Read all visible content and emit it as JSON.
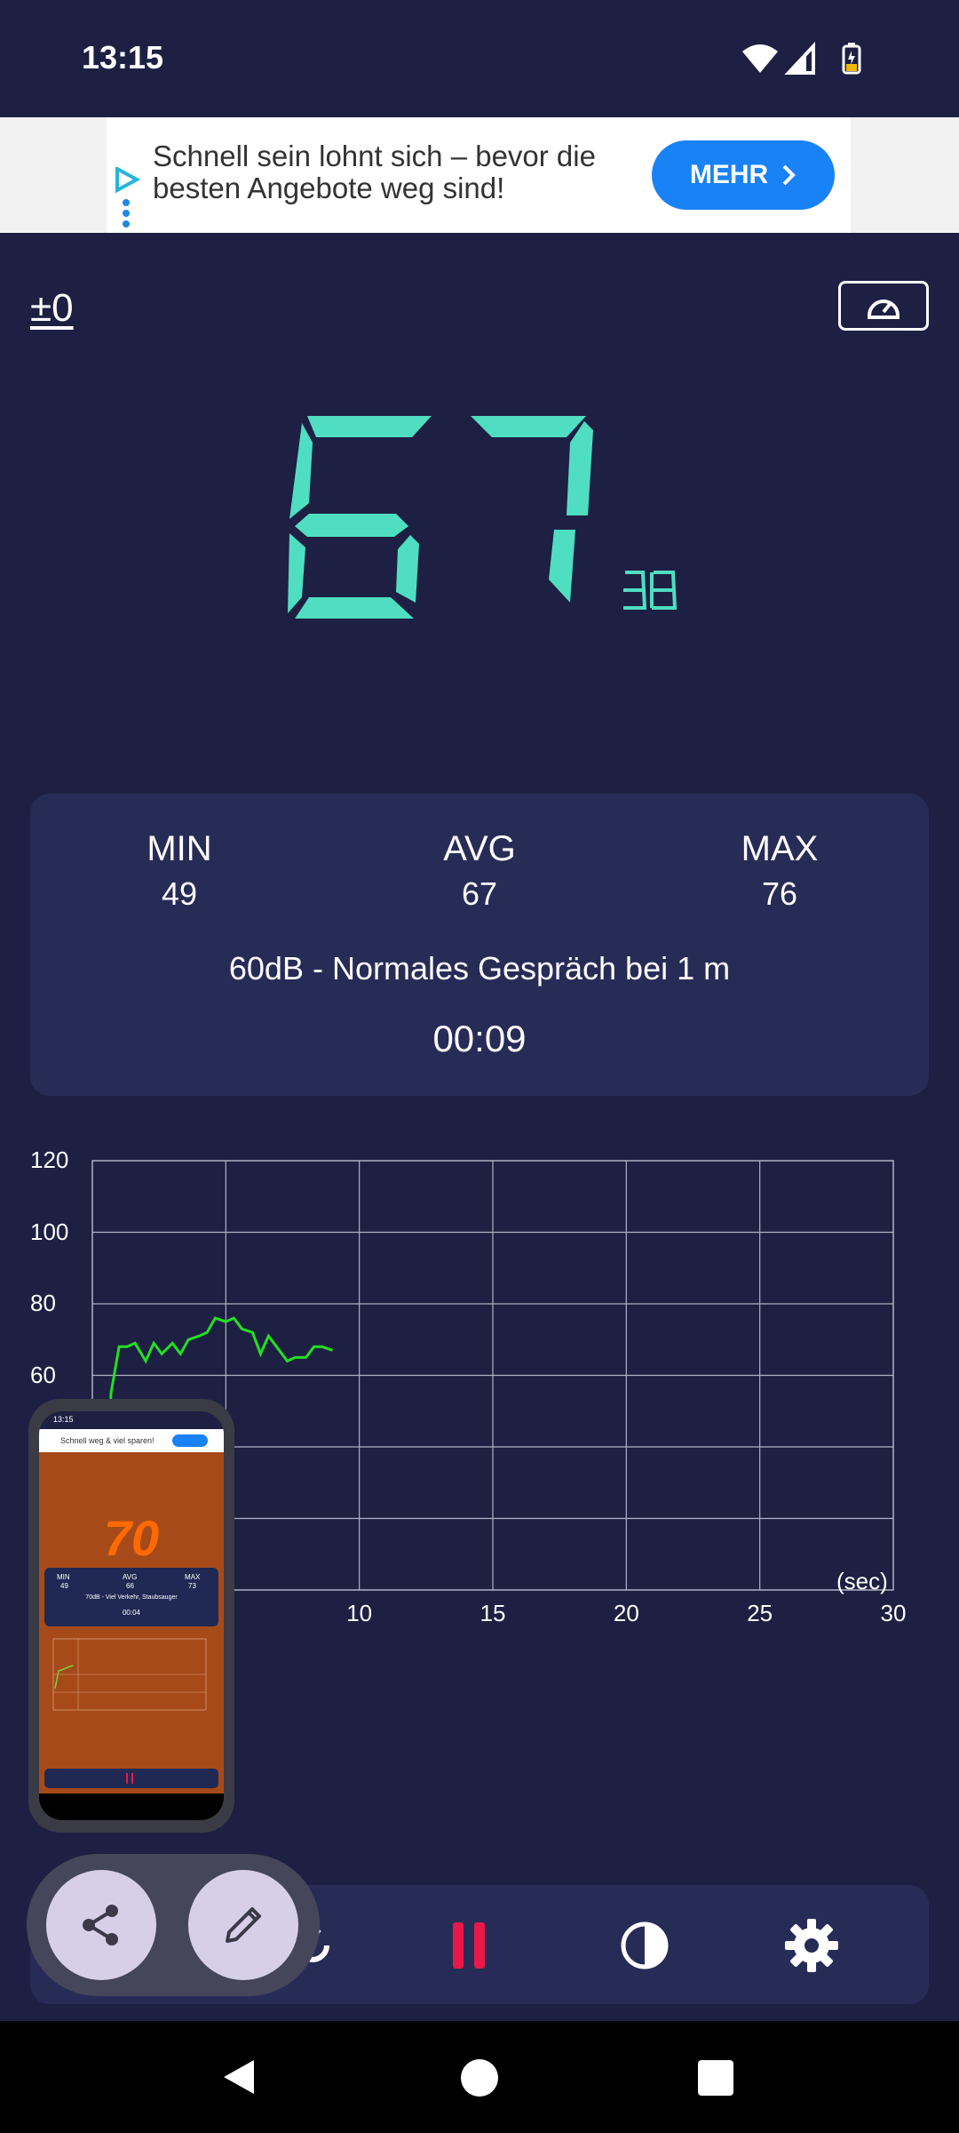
{
  "status_bar": {
    "time": "13:15"
  },
  "ad": {
    "text": "Schnell sein lohnt sich – bevor die besten Angebote weg sind!",
    "button_label": "MEHR"
  },
  "header": {
    "offset_label": "±0"
  },
  "meter": {
    "value": "67",
    "unit": "DB"
  },
  "stats": {
    "min_label": "MIN",
    "min_value": "49",
    "avg_label": "AVG",
    "avg_value": "67",
    "max_label": "MAX",
    "max_value": "76",
    "description": "60dB - Normales Gespräch bei 1 m",
    "timer": "00:09"
  },
  "chart_data": {
    "type": "line",
    "y_ticks": [
      "120",
      "100",
      "80",
      "60"
    ],
    "x_ticks": [
      "10",
      "15",
      "20",
      "25",
      "30"
    ],
    "x_unit": "(sec)",
    "ylim": [
      0,
      120
    ],
    "xlim": [
      0,
      30
    ],
    "grid": true,
    "series": [
      {
        "color": "#22e022",
        "x": [
          0.7,
          1.0,
          1.3,
          1.6,
          2.0,
          2.3,
          2.6,
          3.0,
          3.3,
          3.6,
          4.0,
          4.3,
          4.6,
          5.0,
          5.3,
          5.6,
          6.0,
          6.3,
          6.6,
          7.0,
          7.3,
          7.6,
          8.0,
          8.3,
          8.6,
          9.0
        ],
        "y": [
          55,
          68,
          68,
          69,
          64,
          69,
          66,
          69,
          66,
          70,
          71,
          72,
          76,
          75,
          76,
          73,
          72,
          66,
          71,
          67,
          64,
          65,
          65,
          68,
          68,
          67
        ]
      }
    ]
  },
  "preview": {
    "time": "13:15",
    "ad_text": "Schnell weg & viel sparen!",
    "value": "70",
    "min_label": "MIN",
    "min_value": "49",
    "avg_label": "AVG",
    "avg_value": "66",
    "max_label": "MAX",
    "max_value": "73",
    "description": "70dB - Viel Verkehr, Staubsauger",
    "timer": "00:04"
  },
  "colors": {
    "background": "#1d2042",
    "card": "#272c57",
    "digits": "#4fdec1",
    "line": "#22e022",
    "pause": "#e8194a",
    "ad_button": "#1a82f7"
  }
}
